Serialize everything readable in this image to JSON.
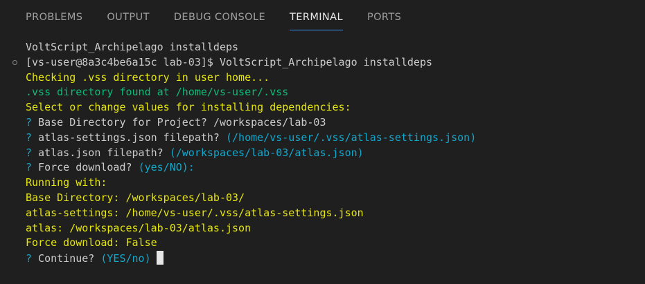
{
  "tabs": [
    "PROBLEMS",
    "OUTPUT",
    "DEBUG CONSOLE",
    "TERMINAL",
    "PORTS"
  ],
  "active_tab": "TERMINAL",
  "terminal": {
    "l1": "VoltScript_Archipelago installdeps",
    "l2": "[vs-user@8a3c4be6a15c lab-03]$ VoltScript_Archipelago installdeps",
    "l3": "Checking .vss directory in user home...",
    "l4": ".vss directory found at /home/vs-user/.vss",
    "l5": "Select or change values for installing dependencies:",
    "q_mark": "?",
    "q1_label": " Base Directory for Project? ",
    "q1_value": "/workspaces/lab-03",
    "q2_label": " atlas-settings.json filepath? ",
    "q2_value": "(/home/vs-user/.vss/atlas-settings.json)",
    "q3_label": " atlas.json filepath? ",
    "q3_value": "(/workspaces/lab-03/atlas.json)",
    "q4_label": " Force download? ",
    "q4_value": "(yes/NO):",
    "l10": "Running with:",
    "l11": "Base Directory: /workspaces/lab-03/",
    "l12": "atlas-settings: /home/vs-user/.vss/atlas-settings.json",
    "l13": "atlas: /workspaces/lab-03/atlas.json",
    "l14": "Force download: False",
    "q5_label": " Continue? ",
    "q5_value": "(YES/no)"
  },
  "colors": {
    "background": "#1f1f1f",
    "yellow": "#e5e510",
    "green": "#0dbc79",
    "cyan": "#11a8cd",
    "tab_active_underline": "#3794ff"
  }
}
